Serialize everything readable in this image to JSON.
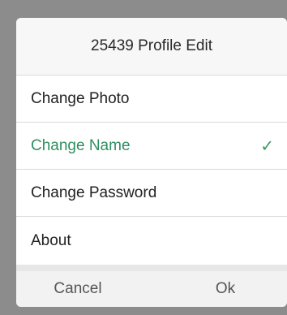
{
  "dialog": {
    "title": "25439 Profile Edit",
    "items": [
      {
        "label": "Change Photo"
      },
      {
        "label": "Change Name",
        "selected": true,
        "check_icon": "checkmark-icon"
      },
      {
        "label": "Change Password"
      },
      {
        "label": "About"
      }
    ],
    "buttons": {
      "cancel": "Cancel",
      "ok": "Ok"
    }
  },
  "colors": {
    "selected_text": "#2e8f5f",
    "checkmark": "#3a9a5c",
    "backdrop": "#8c8c8c",
    "dialog_bg": "#f2f2f2"
  }
}
